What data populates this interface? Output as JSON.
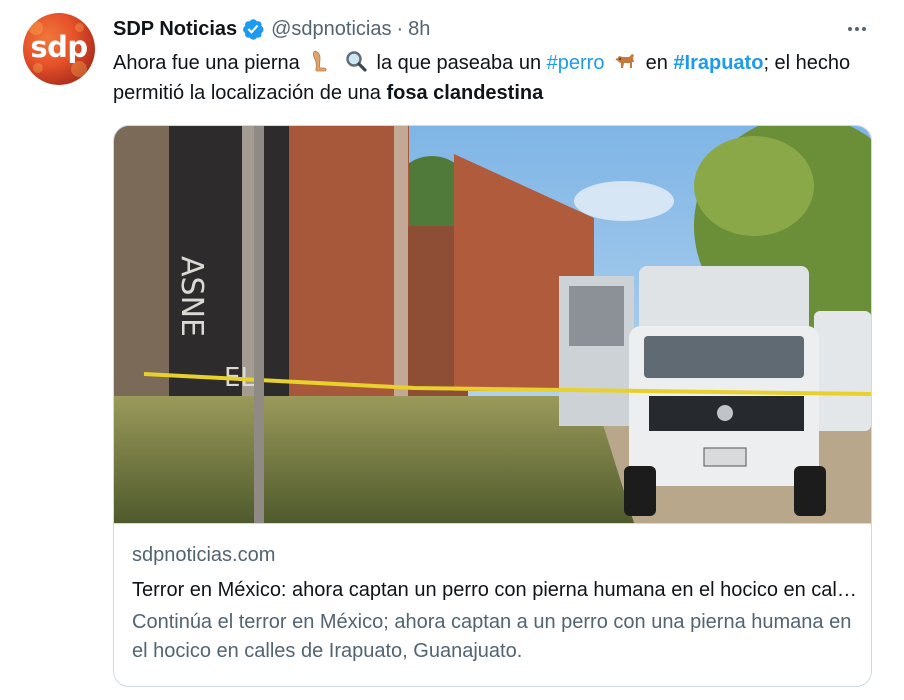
{
  "author": {
    "avatar_text": "sdp",
    "name": "SDP Noticias",
    "handle": "@sdpnoticias",
    "separator": "·",
    "time": "8h"
  },
  "tweet": {
    "text_1": "Ahora fue una pierna",
    "text_2": "la que paseaba un",
    "hashtag_1": "#perro",
    "text_3": "en",
    "hashtag_2": "#Irapuato",
    "text_4": "; el hecho permitió la localización de una",
    "bold_text": "fosa clandestina",
    "emojis": [
      "leg-emoji",
      "magnifying-glass-emoji",
      "dog-emoji"
    ]
  },
  "card": {
    "domain": "sdpnoticias.com",
    "title": "Terror en México: ahora captan un perro con pierna humana en el hocico en calles de Irapuato",
    "description": "Continúa el terror en México; ahora captan a un perro con una pierna humana en el hocico en calles de Irapuato, Guanajuato.",
    "image_icon": "news-photo-image"
  },
  "colors": {
    "link": "#1d9bf0",
    "secondary": "#536471",
    "border": "#cfd9de",
    "avatar": "#e6522a"
  }
}
